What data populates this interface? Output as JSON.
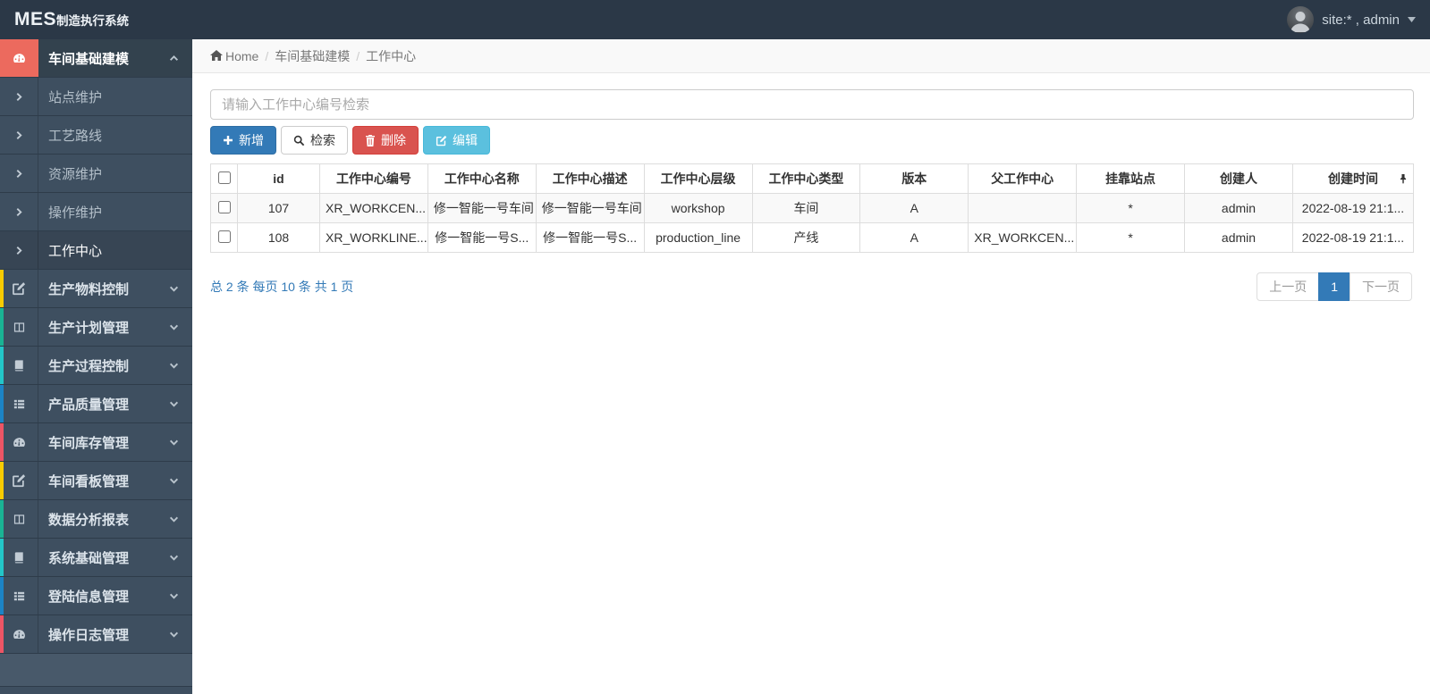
{
  "topbar": {
    "brand_mes": "MES",
    "brand_rest": "制造执行系统",
    "user_label": "site:* , admin",
    "user_icons": [
      "avatar",
      "caret-down-icon"
    ]
  },
  "breadcrumb": {
    "home": "Home",
    "separator": "/",
    "items": [
      "车间基础建模",
      "工作中心"
    ],
    "home_icon": "home-icon"
  },
  "sidebar": {
    "active_group": {
      "label": "车间基础建模",
      "icon": "dashboard",
      "accent": "#ec6a5e",
      "chevron": "chevron-up-icon"
    },
    "submenu": [
      {
        "label": "站点维护",
        "active": false
      },
      {
        "label": "工艺路线",
        "active": false
      },
      {
        "label": "资源维护",
        "active": false
      },
      {
        "label": "操作维护",
        "active": false
      },
      {
        "label": "工作中心",
        "active": true
      }
    ],
    "groups": [
      {
        "label": "生产物料控制",
        "icon": "edit",
        "accent": "#f8cb00"
      },
      {
        "label": "生产计划管理",
        "icon": "columns",
        "accent": "#1ab394"
      },
      {
        "label": "生产过程控制",
        "icon": "book",
        "accent": "#23c6c8"
      },
      {
        "label": "产品质量管理",
        "icon": "list",
        "accent": "#1c84c6"
      },
      {
        "label": "车间库存管理",
        "icon": "dashboard",
        "accent": "#ed5565"
      },
      {
        "label": "车间看板管理",
        "icon": "edit",
        "accent": "#f8cb00"
      },
      {
        "label": "数据分析报表",
        "icon": "columns",
        "accent": "#1ab394"
      },
      {
        "label": "系统基础管理",
        "icon": "book",
        "accent": "#23c6c8"
      },
      {
        "label": "登陆信息管理",
        "icon": "list",
        "accent": "#1c84c6"
      },
      {
        "label": "操作日志管理",
        "icon": "dashboard",
        "accent": "#ed5565"
      }
    ]
  },
  "search": {
    "placeholder": "请输入工作中心编号检索",
    "value": ""
  },
  "toolbar": {
    "add": {
      "label": "新增",
      "icon": "plus"
    },
    "search": {
      "label": "检索",
      "icon": "magnifier"
    },
    "delete": {
      "label": "删除",
      "icon": "trash"
    },
    "edit": {
      "label": "编辑",
      "icon": "pencilSquare"
    }
  },
  "table": {
    "columns": [
      "id",
      "工作中心编号",
      "工作中心名称",
      "工作中心描述",
      "工作中心层级",
      "工作中心类型",
      "版本",
      "父工作中心",
      "挂靠站点",
      "创建人",
      "创建时间"
    ],
    "pin_icon": "pin",
    "rows": [
      [
        "107",
        "XR_WORKCEN...",
        "修一智能一号车间",
        "修一智能一号车间",
        "workshop",
        "车间",
        "A",
        "",
        "*",
        "admin",
        "2022-08-19 21:1..."
      ],
      [
        "108",
        "XR_WORKLINE...",
        "修一智能一号S...",
        "修一智能一号S...",
        "production_line",
        "产线",
        "A",
        "XR_WORKCEN...",
        "*",
        "admin",
        "2022-08-19 21:1..."
      ]
    ]
  },
  "pagination": {
    "summary": "总 2 条 每页 10 条 共 1 页",
    "prev": "上一页",
    "page": "1",
    "next": "下一页"
  },
  "colors": {
    "topbar_bg": "#2b3847",
    "sidebar_row_bg": "#3e4f60",
    "sidebar_bg": "#48596a",
    "active_icon_block": "#ec6a5e",
    "primary": "#337ab7",
    "danger": "#d9534f",
    "info": "#5bc0de",
    "summary_link": "#337ab7"
  }
}
